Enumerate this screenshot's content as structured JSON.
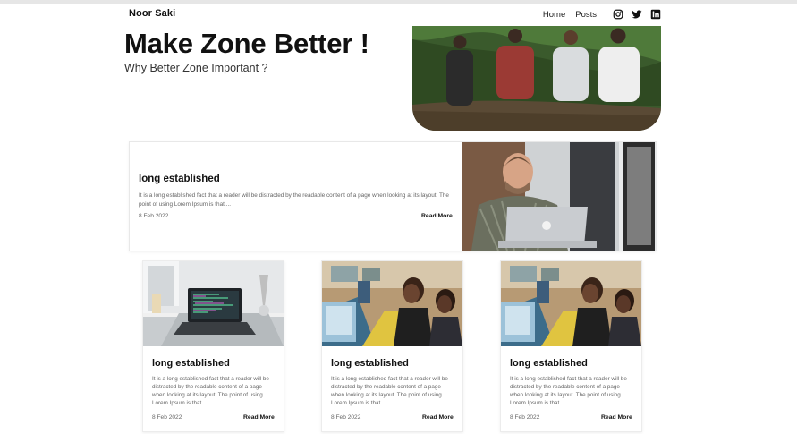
{
  "nav": {
    "brand": "Noor Saki",
    "links": [
      "Home",
      "Posts"
    ],
    "social_icons": [
      "instagram-icon",
      "twitter-icon",
      "linkedin-icon"
    ]
  },
  "hero": {
    "title": "Make Zone Better !",
    "subtitle": "Why Better Zone Important ?"
  },
  "featured": {
    "title": "long established",
    "text": "It is a long established fact that a reader will be distracted by the readable content of a page when looking at its layout. The point of using Lorem Ipsum is that....",
    "date": "8 Feb 2022",
    "read_more": "Read More"
  },
  "cards": [
    {
      "title": "long established",
      "text": "It is a long established fact that a reader will be distracted by the readable content of a page when looking at its layout. The point of using Lorem Ipsum is that....",
      "date": "8 Feb 2022",
      "read_more": "Read More"
    },
    {
      "title": "long established",
      "text": "It is a long established fact that a reader will be distracted by the readable content of a page when looking at its layout. The point of using Lorem Ipsum is that....",
      "date": "8 Feb 2022",
      "read_more": "Read More"
    },
    {
      "title": "long established",
      "text": "It is a long established fact that a reader will be distracted by the readable content of a page when looking at its layout. The point of using Lorem Ipsum is that....",
      "date": "8 Feb 2022",
      "read_more": "Read More"
    }
  ]
}
